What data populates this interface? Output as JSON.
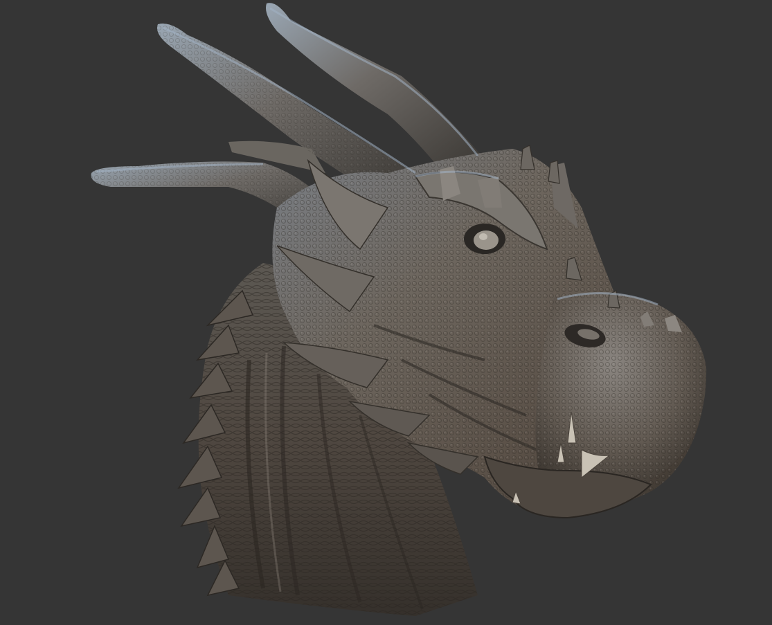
{
  "viewport": {
    "background": "#353535"
  },
  "render": {
    "subject": "dragon-head-sculpt",
    "material_colors": {
      "base": "#6f6a64",
      "shadow": "#2f2c29",
      "highlight": "#b7b2aa",
      "rim_blue": "#7f8fa3",
      "warm": "#8a6f56"
    }
  }
}
